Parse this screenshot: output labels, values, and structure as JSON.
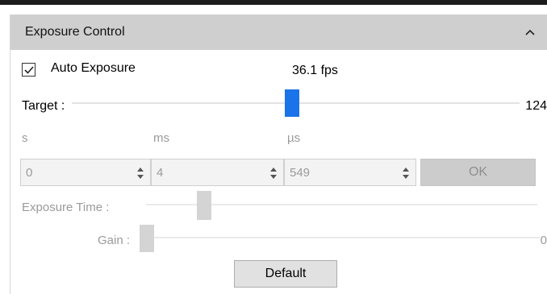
{
  "panel": {
    "title": "Exposure Control",
    "collapse_icon": "chevron-up-icon"
  },
  "auto_exposure": {
    "label": "Auto Exposure",
    "checked": true
  },
  "fps": "36.1 fps",
  "target": {
    "label": "Target :",
    "value": "124"
  },
  "units": {
    "s": "s",
    "ms": "ms",
    "us": "µs"
  },
  "fields": {
    "s_value": "0",
    "ms_value": "4",
    "us_value": "549"
  },
  "ok_label": "OK",
  "exposure_time": {
    "label": "Exposure Time :"
  },
  "gain": {
    "label": "Gain :",
    "value": "0"
  },
  "default_label": "Default",
  "colors": {
    "accent": "#1a73e8",
    "header_bg": "#cfcfcf",
    "disabled_text": "#9a9a9a"
  }
}
